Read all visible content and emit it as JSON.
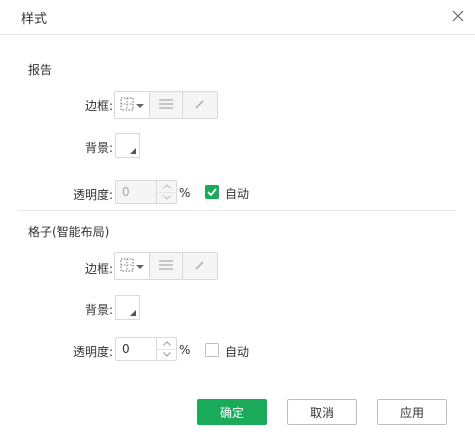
{
  "dialog": {
    "title": "样式",
    "close_icon": "close-icon"
  },
  "colors": {
    "accent": "#1aab5a",
    "border": "#d9d9d9",
    "text": "#333333"
  },
  "report": {
    "section_title": "报告",
    "border_label": "边框:",
    "background_label": "背景:",
    "opacity_label": "透明度:",
    "opacity_value": "0",
    "opacity_unit": "%",
    "opacity_disabled": true,
    "auto_label": "自动",
    "auto_checked": true
  },
  "grid": {
    "section_title": "格子(智能布局)",
    "border_label": "边框:",
    "background_label": "背景:",
    "opacity_label": "透明度:",
    "opacity_value": "0",
    "opacity_unit": "%",
    "opacity_disabled": false,
    "auto_label": "自动",
    "auto_checked": false
  },
  "toolbar_icons": [
    "border-style-icon",
    "chevron-down-icon",
    "line-style-icon",
    "pen-icon"
  ],
  "footer": {
    "ok_label": "确定",
    "cancel_label": "取消",
    "apply_label": "应用"
  }
}
